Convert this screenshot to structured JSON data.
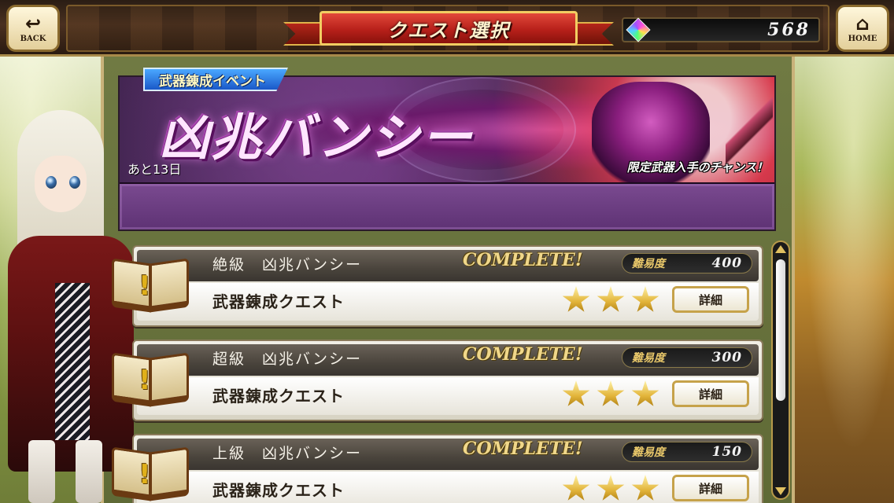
{
  "header": {
    "back_label": "BACK",
    "home_label": "HOME",
    "title": "クエスト選択",
    "gem_count": "568",
    "back_icon": "back-arrow-icon",
    "home_icon": "house-icon",
    "gem_icon": "rainbow-gem-icon"
  },
  "event": {
    "tag": "武器錬成イベント",
    "title": "凶兆バンシー",
    "remaining": "あと13日",
    "chance": "限定武器入手のチャンス！"
  },
  "quests": [
    {
      "name": "絶級　凶兆バンシー",
      "status": "COMPLETE!",
      "difficulty_label": "難易度",
      "difficulty": "400",
      "type": "武器錬成クエスト",
      "stars": 3,
      "detail_label": "詳細"
    },
    {
      "name": "超級　凶兆バンシー",
      "status": "COMPLETE!",
      "difficulty_label": "難易度",
      "difficulty": "300",
      "type": "武器錬成クエスト",
      "stars": 3,
      "detail_label": "詳細"
    },
    {
      "name": "上級　凶兆バンシー",
      "status": "COMPLETE!",
      "difficulty_label": "難易度",
      "difficulty": "150",
      "type": "武器錬成クエスト",
      "stars": 3,
      "detail_label": "詳細"
    }
  ],
  "colors": {
    "ribbon_red": "#b7201a",
    "gold_accent": "#e0b44a",
    "banner_purple": "#5e3274"
  }
}
